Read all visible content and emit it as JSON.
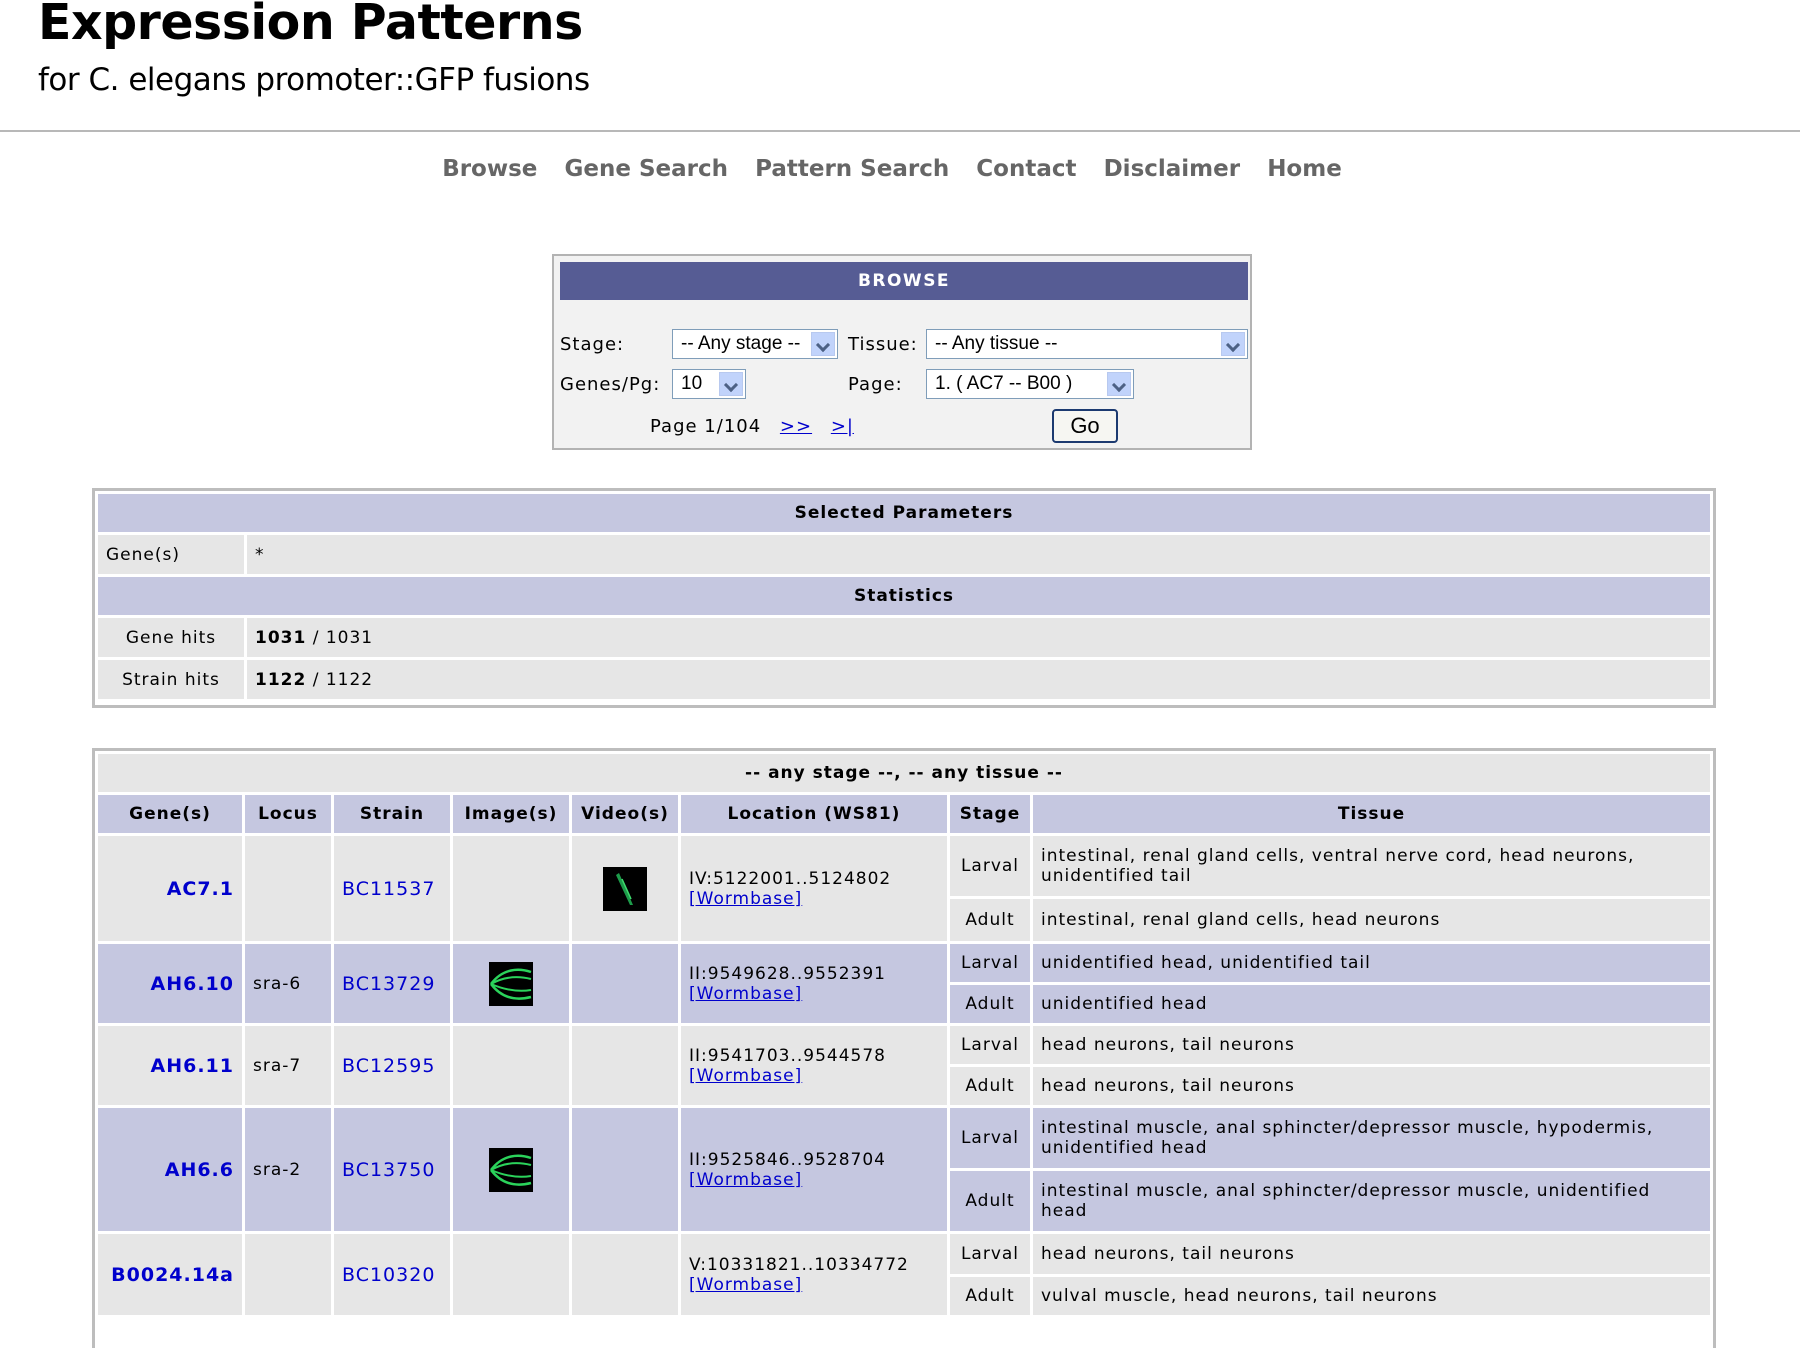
{
  "header": {
    "title": "Expression Patterns",
    "subtitle": "for C. elegans promoter::GFP fusions"
  },
  "nav": [
    "Browse",
    "Gene Search",
    "Pattern Search",
    "Contact",
    "Disclaimer",
    "Home"
  ],
  "browse": {
    "heading": "BROWSE",
    "stage_label": "Stage:",
    "stage_value": "-- Any stage --",
    "tissue_label": "Tissue:",
    "tissue_value": "-- Any tissue --",
    "genes_label": "Genes/Pg:",
    "genes_value": "10",
    "page_label": "Page:",
    "page_value": "1. ( AC7 -- B00 )",
    "page_info": "Page 1/104",
    "next_link": ">>",
    "last_link": ">|",
    "go_label": "Go"
  },
  "params": {
    "heading": "Selected Parameters",
    "gene_label": "Gene(s)",
    "gene_value": "*",
    "stats_heading": "Statistics",
    "gene_hits_label": "Gene hits",
    "gene_hits_bold": "1031",
    "gene_hits_total": " / 1031",
    "strain_hits_label": "Strain hits",
    "strain_hits_bold": "1122",
    "strain_hits_total": " / 1122"
  },
  "results": {
    "caption": "-- any stage --, -- any tissue --",
    "columns": [
      "Gene(s)",
      "Locus",
      "Strain",
      "Image(s)",
      "Video(s)",
      "Location (WS81)",
      "Stage",
      "Tissue"
    ],
    "wormbase_label": "[Wormbase]",
    "rows": [
      {
        "gene": "AC7.1",
        "locus": "",
        "strain": "BC11537",
        "image": "",
        "video": "gfp-video-thumbnail",
        "location": "IV:5122001..5124802",
        "stage1": "Larval",
        "tissue1": "intestinal, renal gland cells, ventral nerve cord, head neurons, unidentified tail",
        "stage2": "Adult",
        "tissue2": "intestinal, renal gland cells, head neurons"
      },
      {
        "gene": "AH6.10",
        "locus": "sra-6",
        "strain": "BC13729",
        "image": "gfp-image-thumbnail",
        "video": "",
        "location": "II:9549628..9552391",
        "stage1": "Larval",
        "tissue1": "unidentified head, unidentified tail",
        "stage2": "Adult",
        "tissue2": "unidentified head"
      },
      {
        "gene": "AH6.11",
        "locus": "sra-7",
        "strain": "BC12595",
        "image": "",
        "video": "",
        "location": "II:9541703..9544578",
        "stage1": "Larval",
        "tissue1": "head neurons, tail neurons",
        "stage2": "Adult",
        "tissue2": "head neurons, tail neurons"
      },
      {
        "gene": "AH6.6",
        "locus": "sra-2",
        "strain": "BC13750",
        "image": "gfp-image-thumbnail",
        "video": "",
        "location": "II:9525846..9528704",
        "stage1": "Larval",
        "tissue1": "intestinal muscle, anal sphincter/depressor muscle, hypodermis, unidentified head",
        "stage2": "Adult",
        "tissue2": "intestinal muscle, anal sphincter/depressor muscle, unidentified head"
      },
      {
        "gene": "B0024.14a",
        "locus": "",
        "strain": "BC10320",
        "image": "",
        "video": "",
        "location": "V:10331821..10334772",
        "stage1": "Larval",
        "tissue1": "head neurons, tail neurons",
        "stage2": "Adult",
        "tissue2": "vulval muscle, head neurons, tail neurons"
      }
    ]
  },
  "colors": {
    "browse_header": "#565c94",
    "header_cell": "#c5c7e0",
    "row_gray": "#e6e6e6",
    "link": "#0000cc"
  }
}
